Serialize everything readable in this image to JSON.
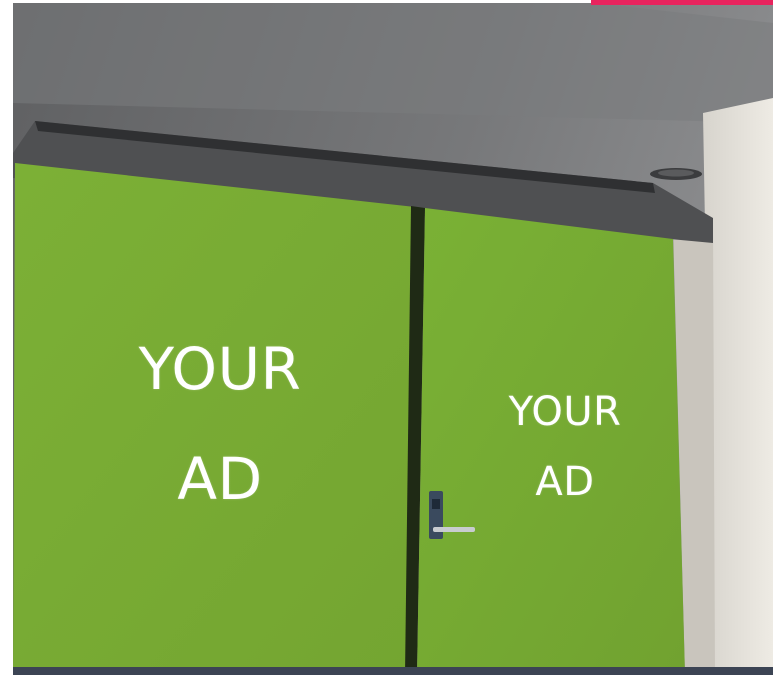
{
  "scene": {
    "left_panel": {
      "line1": "YOUR",
      "line2": "AD"
    },
    "right_panel": {
      "line1": "YOUR",
      "line2": "AD"
    }
  },
  "colors": {
    "accent": "#e8245e",
    "panel_green": "#7aad34",
    "ceiling": "#6c6d6f",
    "wall": "#e6e3dc"
  }
}
